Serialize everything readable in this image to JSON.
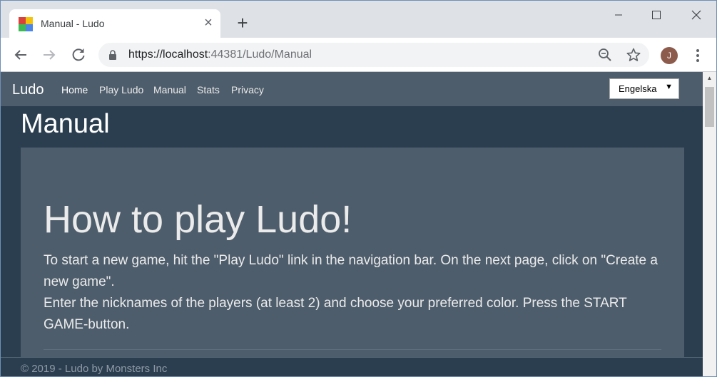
{
  "browser": {
    "tab_title": "Manual - Ludo",
    "new_tab_label": "+",
    "close_tab_label": "×",
    "url_main": "https://localhost",
    "url_rest": ":44381/Ludo/Manual",
    "avatar_initial": "J"
  },
  "site": {
    "brand": "Ludo",
    "nav": [
      {
        "label": "Home"
      },
      {
        "label": "Play Ludo"
      },
      {
        "label": "Manual"
      },
      {
        "label": "Stats"
      },
      {
        "label": "Privacy"
      }
    ],
    "language": "Engelska",
    "page_heading": "Manual",
    "jumbotron": {
      "title": "How to play Ludo!",
      "paragraph_1": "To start a new game, hit the \"Play Ludo\" link in the navigation bar. On the next page, click on \"Create a new game\".",
      "paragraph_2": "Enter the nicknames of the players (at least 2) and choose your preferred color. Press the START GAME-button."
    },
    "footer": "© 2019 - Ludo by Monsters Inc"
  },
  "colors": {
    "navbar": "#4e5d6c",
    "background": "#2b3e50",
    "jumbotron": "#4e5d6c",
    "text": "#ebebeb"
  },
  "icons": [
    "ludo-favicon",
    "close-icon",
    "plus-icon",
    "minimize-icon",
    "maximize-icon",
    "window-close-icon",
    "back-arrow-icon",
    "forward-arrow-icon",
    "reload-icon",
    "lock-icon",
    "zoom-icon",
    "star-icon",
    "avatar",
    "more-vert-icon",
    "caret-down-icon",
    "scroll-up-icon"
  ]
}
